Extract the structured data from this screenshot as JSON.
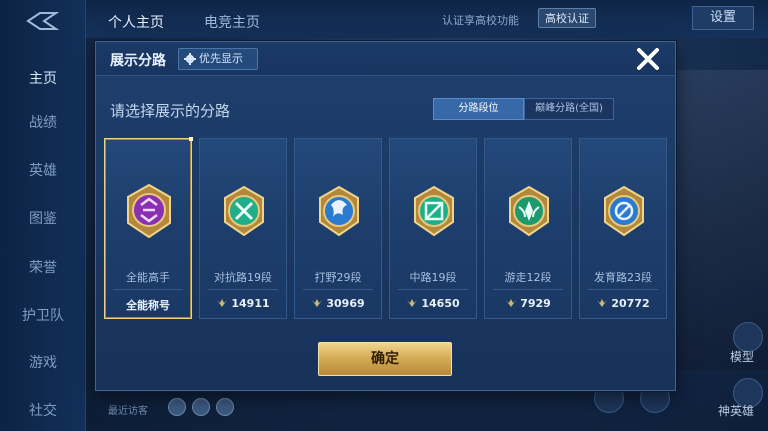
{
  "nav": {
    "items": [
      "主页",
      "战绩",
      "英雄",
      "图鉴",
      "荣誉",
      "护卫队",
      "游戏",
      "社交"
    ]
  },
  "top": {
    "tab_profile": "个人主页",
    "tab_esports": "电竞主页",
    "link_campus": "认证享高校功能",
    "badge_campus": "高校认证",
    "settings": "设置"
  },
  "right": {
    "model": "模型",
    "hero_badge": "神英雄"
  },
  "bottom": {
    "recent": "最近访客"
  },
  "modal": {
    "title": "展示分路",
    "priority_label": "优先显示",
    "subtitle": "请选择展示的分路",
    "segment_left": "分路段位",
    "segment_right": "巅峰分路(全国)",
    "confirm": "确定"
  },
  "cards": [
    {
      "name": "全能高手",
      "value": "全能称号",
      "selected": true,
      "icon": "all-round-emblem-icon"
    },
    {
      "name": "对抗路19段",
      "value": "14911",
      "selected": false,
      "icon": "clash-lane-emblem-icon"
    },
    {
      "name": "打野29段",
      "value": "30969",
      "selected": false,
      "icon": "jungle-emblem-icon"
    },
    {
      "name": "中路19段",
      "value": "14650",
      "selected": false,
      "icon": "mid-lane-emblem-icon"
    },
    {
      "name": "游走12段",
      "value": "7929",
      "selected": false,
      "icon": "roam-emblem-icon"
    },
    {
      "name": "发育路23段",
      "value": "20772",
      "selected": false,
      "icon": "farm-lane-emblem-icon"
    }
  ],
  "colors": {
    "accent_gold": "#d6ad58",
    "panel_blue": "#1e3f6d",
    "selected_tab": "#3769a8"
  }
}
